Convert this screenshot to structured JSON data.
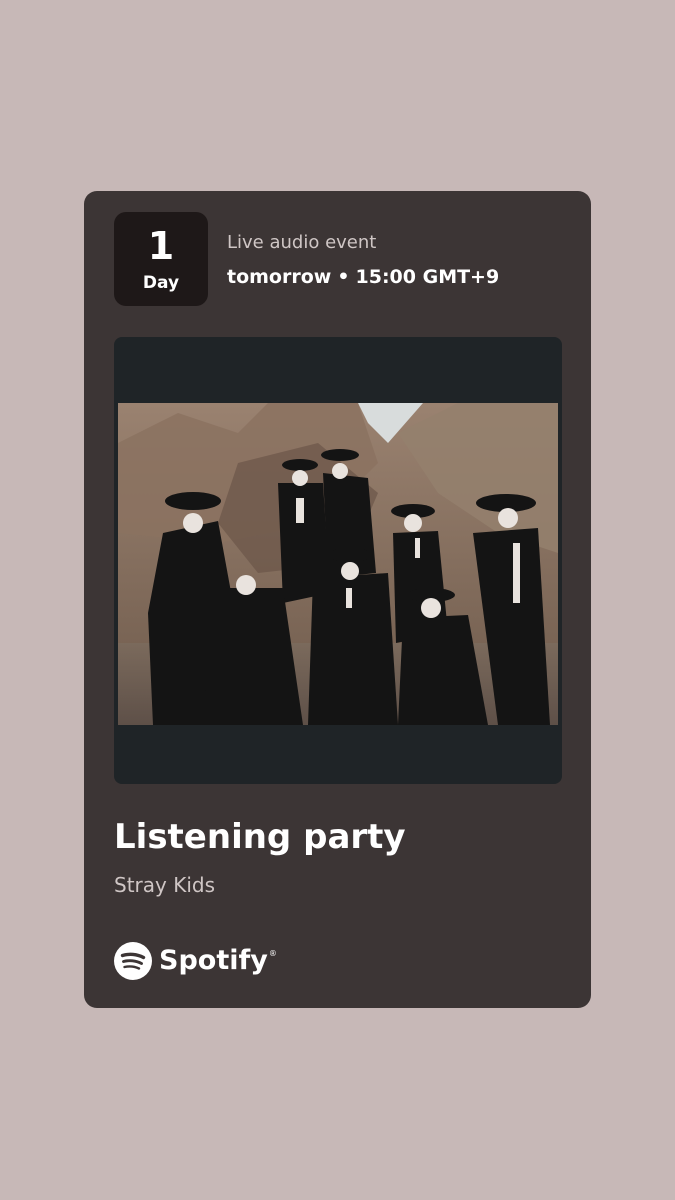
{
  "countdown": {
    "number": "1",
    "unit": "Day"
  },
  "event": {
    "type": "Live audio event",
    "when": "tomorrow",
    "separator": "•",
    "time": "15:00 GMT+9"
  },
  "artwork": {
    "description_icon": "group-photo-image"
  },
  "title": "Listening party",
  "artist": "Stray Kids",
  "brand": {
    "name": "Spotify",
    "trademark": "®",
    "icon": "spotify-logo-icon"
  },
  "colors": {
    "background": "#c7b8b7",
    "card": "#3c3535",
    "badge": "#1e1818",
    "artwork_bg": "#1f2427",
    "text_primary": "#ffffff",
    "text_secondary": "#cfc6c5"
  }
}
